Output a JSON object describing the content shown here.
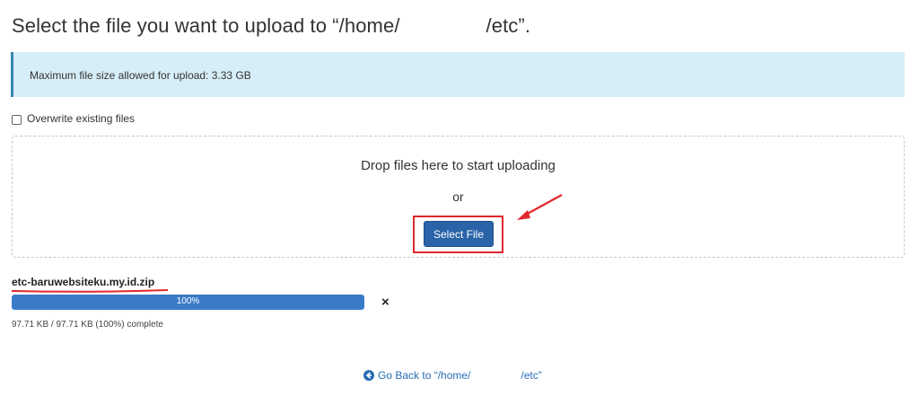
{
  "heading": {
    "prefix": "Select the file you want to upload to “/home/",
    "suffix": "/etc”."
  },
  "alert": {
    "text": "Maximum file size allowed for upload: 3.33 GB"
  },
  "overwrite": {
    "label": "Overwrite existing files",
    "checked": false
  },
  "dropzone": {
    "drop_text": "Drop files here to start uploading",
    "or_text": "or",
    "select_label": "Select File"
  },
  "upload": {
    "file_name": "etc-baruwebsiteku.my.id.zip",
    "progress_label": "100%",
    "progress_fraction": 1.0,
    "cancel_icon": "×",
    "complete_text": "97.71 KB / 97.71 KB (100%) complete"
  },
  "back_link": {
    "prefix": "Go Back to “/home/",
    "suffix": "/etc”",
    "icon": "arrow-left-circle-icon"
  },
  "colors": {
    "accent": "#2a63a8",
    "alert_bg": "#d6eef8",
    "annotation_red": "#e0272c",
    "progress": "#3a7bc8"
  }
}
